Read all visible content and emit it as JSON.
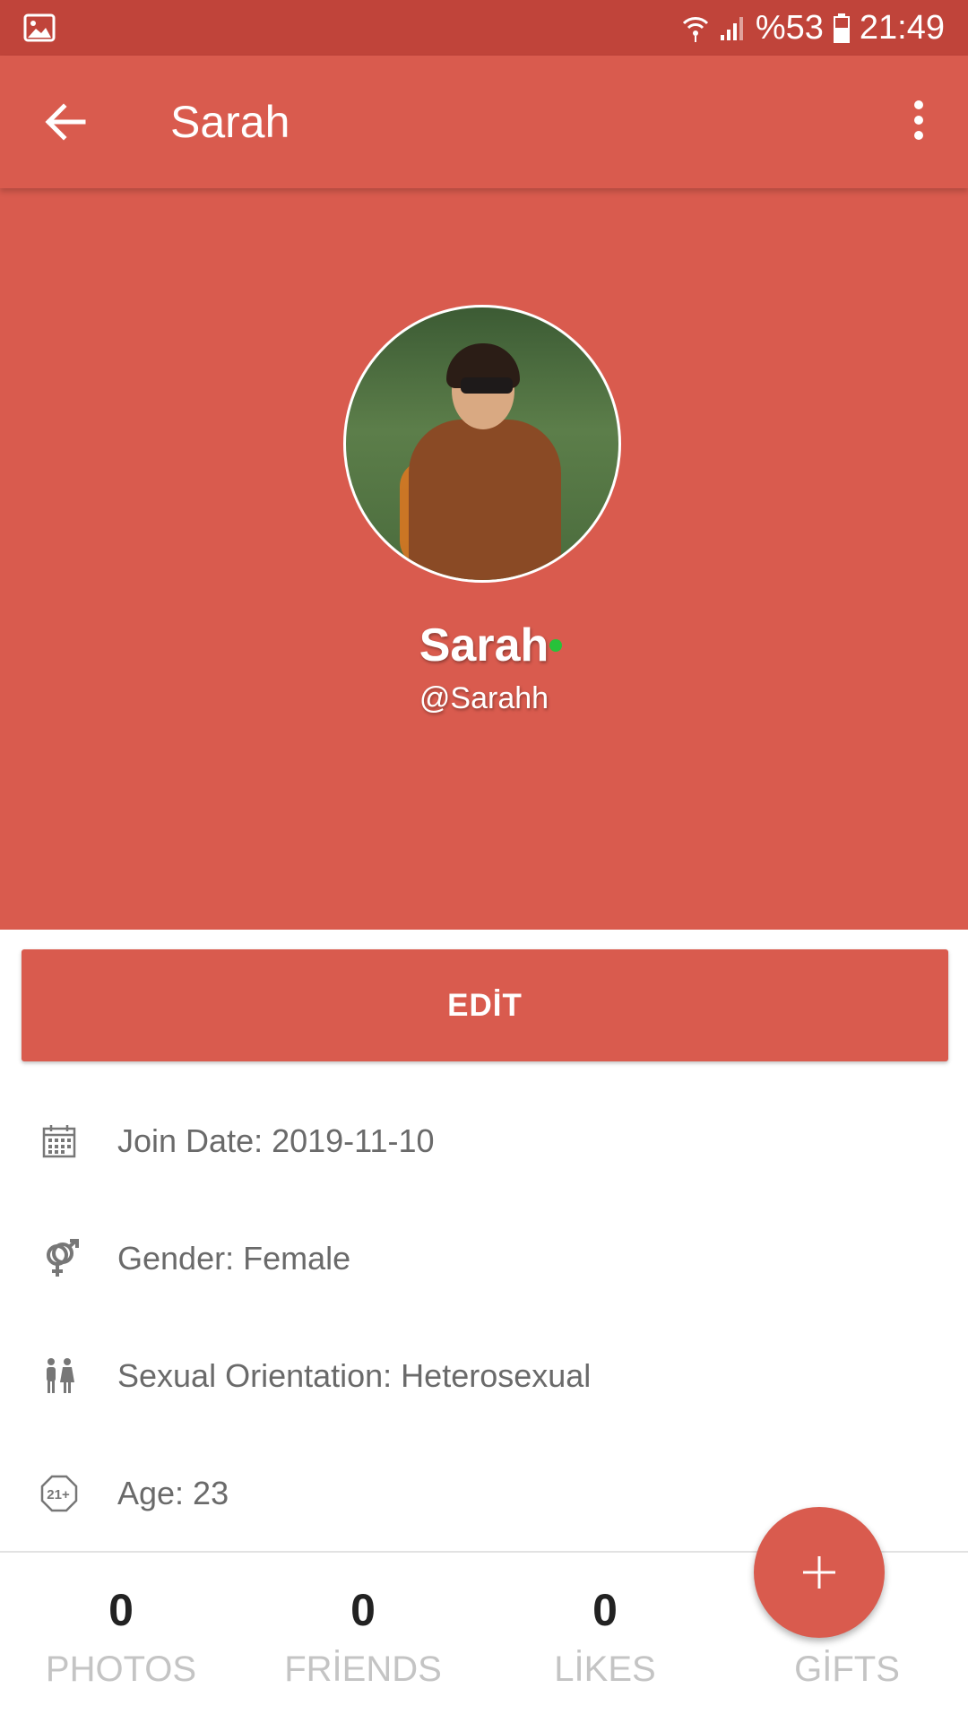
{
  "status_bar": {
    "battery": "%53",
    "time": "21:49",
    "icons": [
      "image-notification-icon",
      "wifi-icon",
      "signal-icon",
      "battery-icon"
    ]
  },
  "app_bar": {
    "title": "Sarah",
    "icons": [
      "back-arrow-icon",
      "more-vert-icon"
    ]
  },
  "profile": {
    "name": "Sarah",
    "handle": "@Sarahh",
    "online": true,
    "online_color": "#27c23a"
  },
  "edit_label": "EDİT",
  "info": [
    {
      "icon": "calendar-icon",
      "text": "Join Date: 2019-11-10"
    },
    {
      "icon": "gender-icon",
      "text": "Gender: Female"
    },
    {
      "icon": "couple-icon",
      "text": "Sexual Orientation: Heterosexual"
    },
    {
      "icon": "age-21-plus-icon",
      "text": "Age: 23"
    }
  ],
  "stats": [
    {
      "count": "0",
      "label": "PHOTOS"
    },
    {
      "count": "0",
      "label": "FRİENDS"
    },
    {
      "count": "0",
      "label": "LİKES"
    },
    {
      "count": "",
      "label": "GİFTS"
    }
  ],
  "colors": {
    "accent": "#d95b4e",
    "status_bar": "#c0443a"
  }
}
